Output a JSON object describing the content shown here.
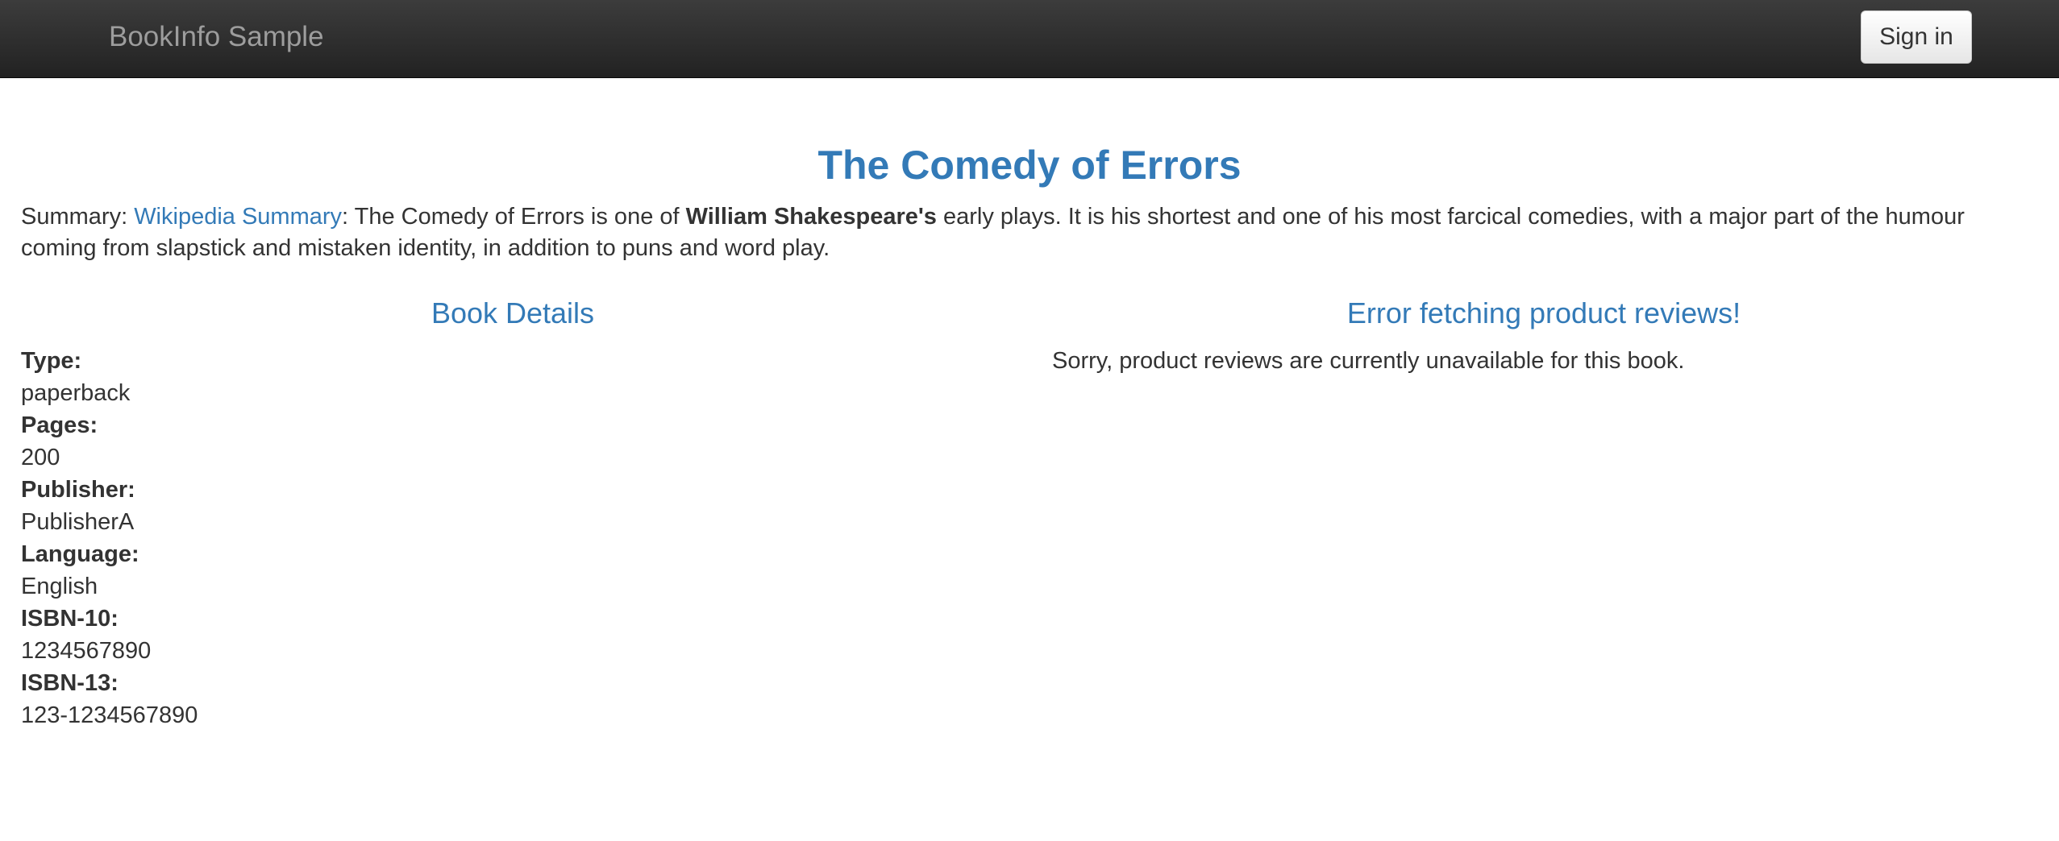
{
  "navbar": {
    "brand": "BookInfo Sample",
    "signin_label": "Sign in"
  },
  "book": {
    "title": "The Comedy of Errors",
    "summary_prefix": "Summary: ",
    "summary_link": "Wikipedia Summary",
    "summary_text_1": ": The Comedy of Errors is one of ",
    "summary_bold": "William Shakespeare's",
    "summary_text_2": " early plays. It is his shortest and one of his most farcical comedies, with a major part of the humour coming from slapstick and mistaken identity, in addition to puns and word play."
  },
  "details": {
    "heading": "Book Details",
    "items": [
      {
        "label": "Type:",
        "value": "paperback"
      },
      {
        "label": "Pages:",
        "value": "200"
      },
      {
        "label": "Publisher:",
        "value": "PublisherA"
      },
      {
        "label": "Language:",
        "value": "English"
      },
      {
        "label": "ISBN-10:",
        "value": "1234567890"
      },
      {
        "label": "ISBN-13:",
        "value": "123-1234567890"
      }
    ]
  },
  "reviews": {
    "heading": "Error fetching product reviews!",
    "message": "Sorry, product reviews are currently unavailable for this book."
  }
}
